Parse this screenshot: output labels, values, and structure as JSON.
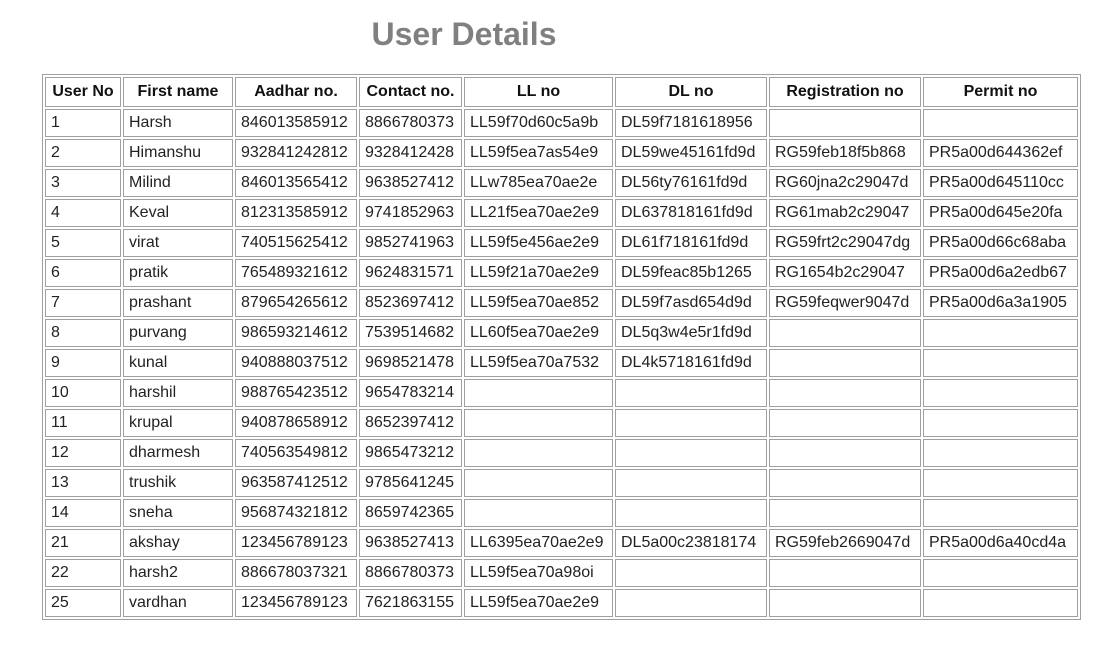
{
  "page": {
    "title": "User Details"
  },
  "table": {
    "headers": [
      "User No",
      "First name",
      "Aadhar no.",
      "Contact no.",
      "LL no",
      "DL no",
      "Registration no",
      "Permit no"
    ],
    "rows": [
      [
        "1",
        "Harsh",
        "846013585912",
        "8866780373",
        "LL59f70d60c5a9b",
        "DL59f7181618956",
        "",
        ""
      ],
      [
        "2",
        "Himanshu",
        "932841242812",
        "9328412428",
        "LL59f5ea7as54e9",
        "DL59we45161fd9d",
        "RG59feb18f5b868",
        "PR5a00d644362ef"
      ],
      [
        "3",
        "Milind",
        "846013565412",
        "9638527412",
        "LLw785ea70ae2e",
        "DL56ty76161fd9d",
        "RG60jna2c29047d",
        "PR5a00d645110cc"
      ],
      [
        "4",
        "Keval",
        "812313585912",
        "9741852963",
        "LL21f5ea70ae2e9",
        "DL637818161fd9d",
        "RG61mab2c29047",
        "PR5a00d645e20fa"
      ],
      [
        "5",
        "virat",
        "740515625412",
        "9852741963",
        "LL59f5e456ae2e9",
        "DL61f718161fd9d",
        "RG59frt2c29047dg",
        "PR5a00d66c68aba"
      ],
      [
        "6",
        "pratik",
        "765489321612",
        "9624831571",
        "LL59f21a70ae2e9",
        "DL59feac85b1265",
        "RG1654b2c29047",
        "PR5a00d6a2edb67"
      ],
      [
        "7",
        "prashant",
        "879654265612",
        "8523697412",
        "LL59f5ea70ae852",
        "DL59f7asd654d9d",
        "RG59feqwer9047d",
        "PR5a00d6a3a1905"
      ],
      [
        "8",
        "purvang",
        "986593214612",
        "7539514682",
        "LL60f5ea70ae2e9",
        "DL5q3w4e5r1fd9d",
        "",
        ""
      ],
      [
        "9",
        "kunal",
        "940888037512",
        "9698521478",
        "LL59f5ea70a7532",
        "DL4k5718161fd9d",
        "",
        ""
      ],
      [
        "10",
        "harshil",
        "988765423512",
        "9654783214",
        "",
        "",
        "",
        ""
      ],
      [
        "11",
        "krupal",
        "940878658912",
        "8652397412",
        "",
        "",
        "",
        ""
      ],
      [
        "12",
        "dharmesh",
        "740563549812",
        "9865473212",
        "",
        "",
        "",
        ""
      ],
      [
        "13",
        "trushik",
        "963587412512",
        "9785641245",
        "",
        "",
        "",
        ""
      ],
      [
        "14",
        "sneha",
        "956874321812",
        "8659742365",
        "",
        "",
        "",
        ""
      ],
      [
        "21",
        "akshay",
        "123456789123",
        "9638527413",
        "LL6395ea70ae2e9",
        "DL5a00c23818174",
        "RG59feb2669047d",
        "PR5a00d6a40cd4a"
      ],
      [
        "22",
        "harsh2",
        "886678037321",
        "8866780373",
        "LL59f5ea70a98oi",
        "",
        "",
        ""
      ],
      [
        "25",
        "vardhan",
        "123456789123",
        "7621863155",
        "LL59f5ea70ae2e9",
        "",
        "",
        ""
      ]
    ]
  }
}
